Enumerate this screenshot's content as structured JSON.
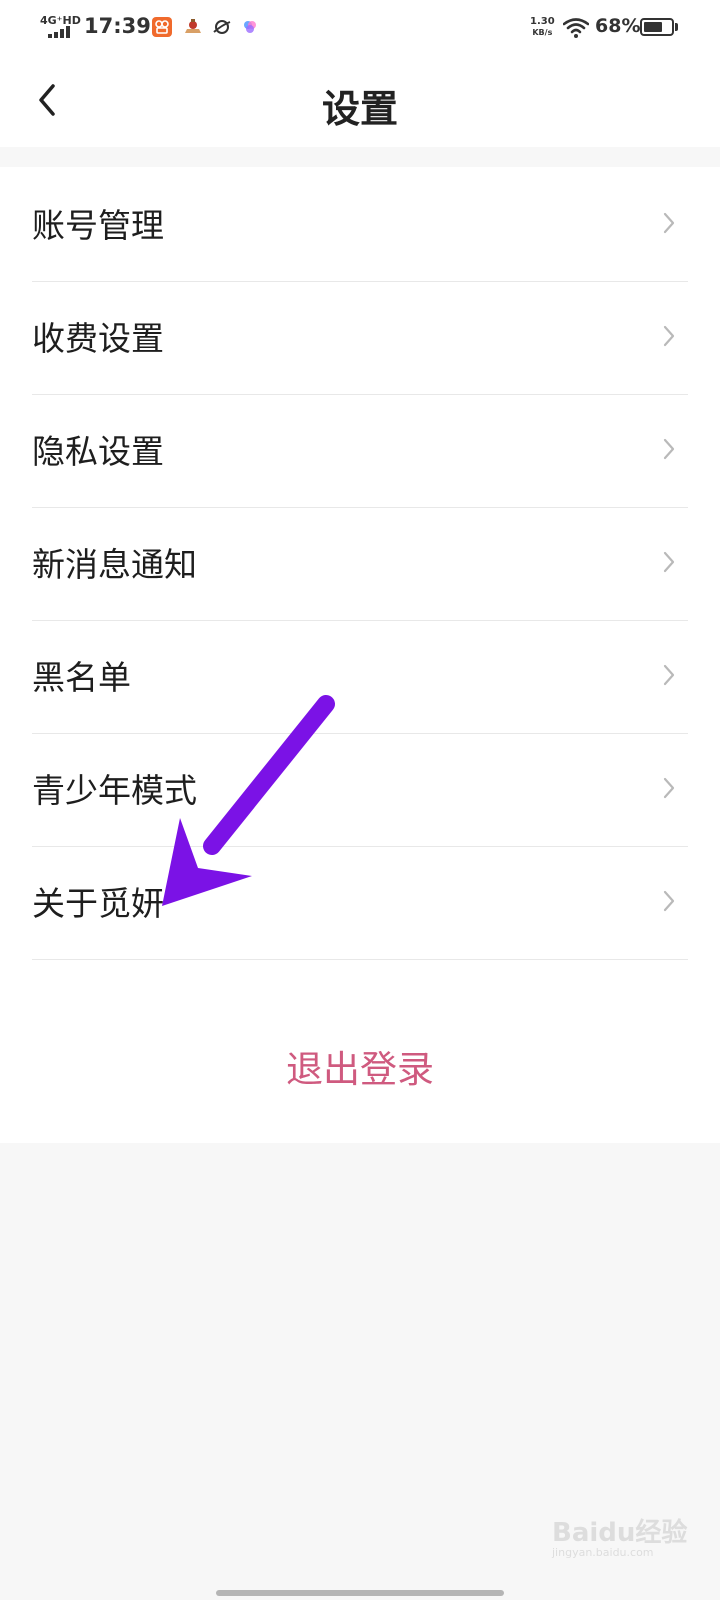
{
  "status_bar": {
    "network": "4G⁺HD",
    "time": "17:39",
    "speed_top": "1.30",
    "speed_unit": "KB/s",
    "battery_percent": "68%",
    "battery_level": 0.68,
    "icons": [
      "kuaishou-app-icon",
      "game-app-icon",
      "planet-app-icon",
      "color-app-icon",
      "wifi-icon",
      "battery-icon"
    ]
  },
  "header": {
    "title": "设置",
    "back_icon": "chevron-left-icon"
  },
  "settings": {
    "items": [
      {
        "label": "账号管理"
      },
      {
        "label": "收费设置"
      },
      {
        "label": "隐私设置"
      },
      {
        "label": "新消息通知"
      },
      {
        "label": "黑名单"
      },
      {
        "label": "青少年模式"
      },
      {
        "label": "关于觅妍"
      }
    ],
    "chevron_icon": "chevron-right-icon",
    "logout_label": "退出登录"
  },
  "annotation": {
    "color": "#7b12e6",
    "icon": "arrow-icon"
  },
  "watermark": {
    "text": "Baidu经验",
    "sub": "jingyan.baidu.com"
  },
  "colors": {
    "logout": "#cf5a7f",
    "background": "#f7f7f7",
    "list_background": "#ffffff"
  }
}
